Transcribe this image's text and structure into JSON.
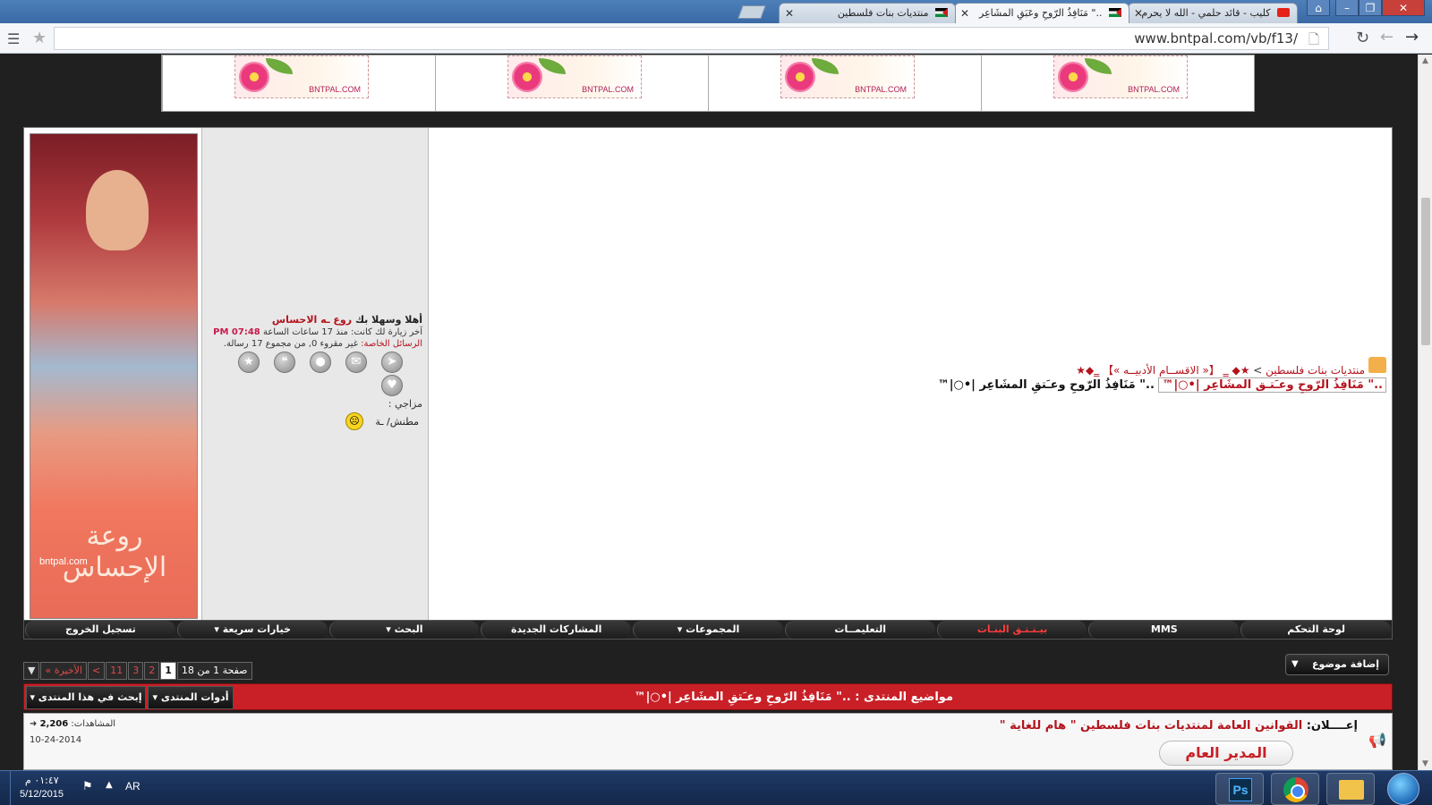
{
  "browser": {
    "tabs": [
      {
        "title": "كليب - قائد حلمي - الله لا يحرم",
        "active": false
      },
      {
        "title": "..\" مَنَافِذُ الرّوحِ وعَبَقِ المشَاعِر",
        "active": true
      },
      {
        "title": "منتديات بنات فلسطين",
        "active": false
      }
    ],
    "url": "www.bntpal.com/vb/f13/"
  },
  "banners": [
    {
      "label": "BNTPAL.COM"
    },
    {
      "label": "BNTPAL.COM"
    },
    {
      "label": "BNTPAL.COM"
    },
    {
      "label": "BNTPAL.COM"
    }
  ],
  "sidebar_image": {
    "text": "روعة الإحساس",
    "url": "bntpal.com"
  },
  "user_panel": {
    "welcome_prefix": "أهلا وسهلا بك",
    "username": "روع ـه الاحساس",
    "last_visit_prefix": "آخر زيارة لك كانت: منذ 17 ساعات الساعة",
    "last_visit_time": "07:48 PM",
    "pm_label": "الرسائل الخاصة:",
    "pm_text": "غير مقروء 0, من مجموع 17 رسالة.",
    "mood_label": "مزاجي :",
    "mood_value": "مطنش/ ـة"
  },
  "breadcrumb": {
    "root": "منتديات بنات فلسطين",
    "separator": ">",
    "section": "★◆ ‗ 【« الاقســام الأدبيــه »】 ‗◆★"
  },
  "thread": {
    "boxed_title": "..\" مَنَافِذُ الرّوحِ وعـَتـق المشَاعِر |•○|™",
    "plain_title": "..\" مَنَافِذُ الرّوحِ وعـَتقِ المشَاعِر |•○|™"
  },
  "navbar": [
    {
      "label": "لوحة التحكم",
      "highlight": false
    },
    {
      "label": "MMS",
      "highlight": false
    },
    {
      "label": "بيـنـتـق البنـات",
      "highlight": true
    },
    {
      "label": "التعليمــات",
      "highlight": false
    },
    {
      "label": "المجموعات ▾",
      "highlight": false
    },
    {
      "label": "المشاركات الجديدة",
      "highlight": false
    },
    {
      "label": "البحث ▾",
      "highlight": false
    },
    {
      "label": "خيارات سريعة ▾",
      "highlight": false
    },
    {
      "label": "تسجيل الخروج",
      "highlight": false
    }
  ],
  "add_topic": "إضافة موضوع",
  "pagination": {
    "label": "صفحة 1 من 18",
    "pages": [
      "1",
      "2",
      "3",
      "11",
      ">",
      "الأخيرة »"
    ],
    "current": "1"
  },
  "forum_bar": {
    "title": "مواضيع المنتدى : ..\" مَنَافِذُ الرّوحِ وعـَتقِ المشَاعِر |•○|™",
    "tools": "أدوات المنتدى ▾",
    "search": "إبحث في هذا المنتدى ▾"
  },
  "announcement": {
    "prefix": "إعــــلان:",
    "title": "القوانين العامة لمنتديات بنات فلسطين \" هام للغاية \"",
    "views_label": "المشاهدات:",
    "views": "2,206",
    "date": "10-24-2014",
    "badge": "المدير العام"
  },
  "taskbar": {
    "time": "٠١:٤٧ م",
    "date": "5/12/2015",
    "lang": "AR"
  },
  "colors": {
    "accent_red": "#c91f26",
    "link_red": "#b3131d",
    "dark": "#202020"
  }
}
